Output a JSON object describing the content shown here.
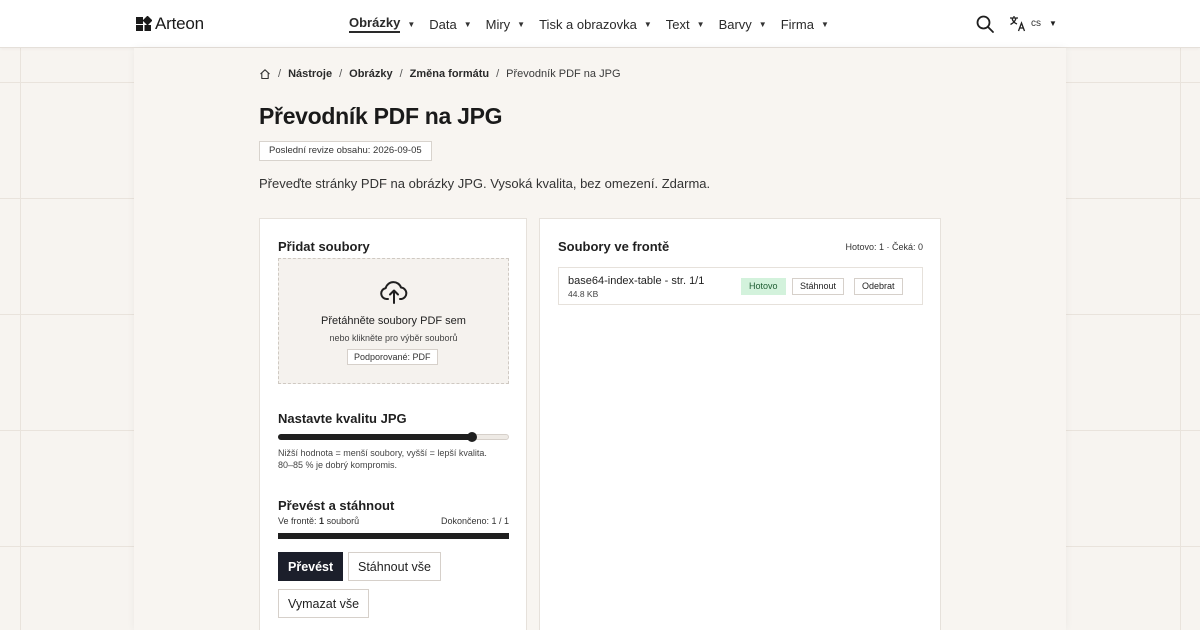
{
  "brand": {
    "name": "Arteon"
  },
  "nav": {
    "items": [
      {
        "label": "Obrázky",
        "active": true
      },
      {
        "label": "Data",
        "active": false
      },
      {
        "label": "Miry",
        "active": false
      },
      {
        "label": "Tisk a obrazovka",
        "active": false
      },
      {
        "label": "Text",
        "active": false
      },
      {
        "label": "Barvy",
        "active": false
      },
      {
        "label": "Firma",
        "active": false
      }
    ],
    "caret": "▼",
    "language": "cs"
  },
  "breadcrumb": {
    "separator": "/",
    "items": [
      "Nástroje",
      "Obrázky",
      "Změna formátu"
    ],
    "current": "Převodník PDF na JPG"
  },
  "page": {
    "title": "Převodník PDF na JPG",
    "revision": "Poslední revize obsahu: 2026-09-05",
    "intro": "Převeďte stránky PDF na obrázky JPG. Vysoká kvalita, bez omezení. Zdarma."
  },
  "upload": {
    "heading": "Přidat soubory",
    "drop_title": "Přetáhněte soubory PDF sem",
    "drop_sub": "nebo klikněte pro výběr souborů",
    "supported": "Podporované: PDF"
  },
  "quality": {
    "heading": "Nastavte kvalitu JPG",
    "value_fraction": 0.84,
    "hint_line1": "Nižší hodnota = menší soubory, vyšší = lepší kvalita.",
    "hint_line2": "80–85 % je dobrý kompromis."
  },
  "convert": {
    "heading": "Převést a stáhnout",
    "queue_prefix": "Ve frontě:",
    "queue_count": "1",
    "queue_suffix": "souborů",
    "completed": "Dokončeno: 1 / 1",
    "progress_fraction": 1.0,
    "convert_label": "Převést",
    "download_all_label": "Stáhnout vše",
    "clear_all_label": "Vymazat vše"
  },
  "queue": {
    "heading": "Soubory ve frontě",
    "stats": "Hotovo: 1 · Čeká: 0",
    "files": [
      {
        "name": "base64-index-table - str. 1/1",
        "size": "44.8 KB",
        "status": "Hotovo",
        "download_label": "Stáhnout",
        "remove_label": "Odebrat"
      }
    ]
  },
  "colors": {
    "primary_button": "#1c1f2b",
    "status_done_bg": "#d3f2dc",
    "status_done_text": "#1f5e33",
    "page_background": "#f7f4f0"
  }
}
